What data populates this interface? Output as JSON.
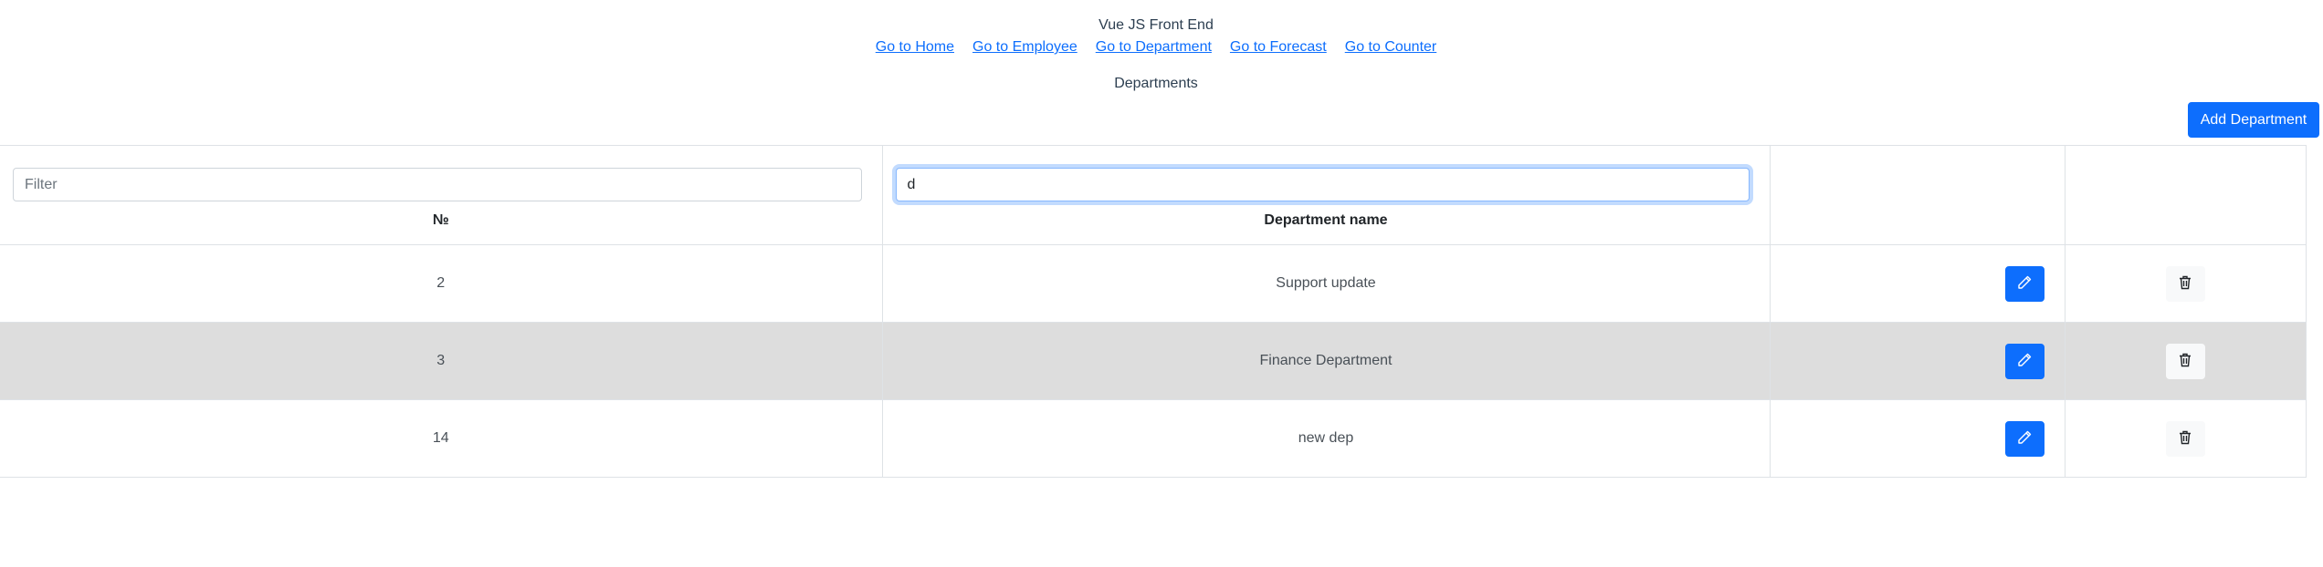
{
  "app": {
    "title": "Vue JS Front End"
  },
  "nav": [
    {
      "label": "Go to Home"
    },
    {
      "label": "Go to Employee"
    },
    {
      "label": "Go to Department"
    },
    {
      "label": "Go to Forecast"
    },
    {
      "label": "Go to Counter"
    }
  ],
  "page": {
    "heading": "Departments",
    "add_button_label": "Add Department"
  },
  "table": {
    "filters": {
      "id_placeholder": "Filter",
      "id_value": "",
      "name_placeholder": "Filter",
      "name_value": "d"
    },
    "columns": {
      "id": "№",
      "name": "Department name"
    },
    "rows": [
      {
        "id": "2",
        "name": "Support update"
      },
      {
        "id": "3",
        "name": "Finance Department"
      },
      {
        "id": "14",
        "name": "new dep"
      }
    ],
    "hovered_row_index": 1
  },
  "icons": {
    "edit": "pencil-icon",
    "delete": "trash-icon"
  },
  "colors": {
    "primary": "#0d6efd",
    "hover_row": "#dddddd",
    "link": "#0d6efd"
  }
}
